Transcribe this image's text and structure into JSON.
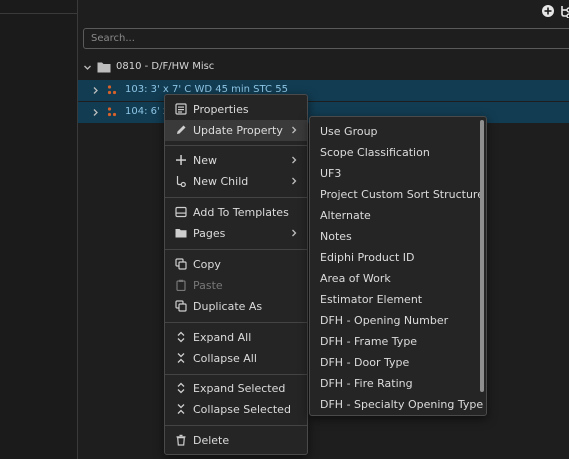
{
  "search": {
    "placeholder": "Search..."
  },
  "tree": {
    "group": {
      "label": "0810 - D/F/HW Misc"
    },
    "items": [
      {
        "label": "103: 3' x 7' C WD 45 min STC 55"
      },
      {
        "label": "104: 6' x"
      }
    ]
  },
  "context_menu": {
    "properties": "Properties",
    "update_property": "Update Property",
    "new": "New",
    "new_child": "New Child",
    "add_to_templates": "Add To Templates",
    "pages": "Pages",
    "copy": "Copy",
    "paste": "Paste",
    "duplicate_as": "Duplicate As",
    "expand_all": "Expand All",
    "collapse_all": "Collapse All",
    "expand_selected": "Expand Selected",
    "collapse_selected": "Collapse Selected",
    "delete": "Delete"
  },
  "submenu": {
    "items": [
      "Use Group",
      "Scope Classification",
      "UF3",
      "Project Custom Sort Structure",
      "Alternate",
      "Notes",
      "Ediphi Product ID",
      "Area of Work",
      "Estimator Element",
      "DFH - Opening Number",
      "DFH - Frame Type",
      "DFH - Door Type",
      "DFH - Fire Rating",
      "DFH - Specialty Opening Type"
    ]
  },
  "colors": {
    "background": "#1e1e1e",
    "selection": "#123c52",
    "accent_dots": "#d4622a",
    "item_text": "#8ec6e6"
  }
}
